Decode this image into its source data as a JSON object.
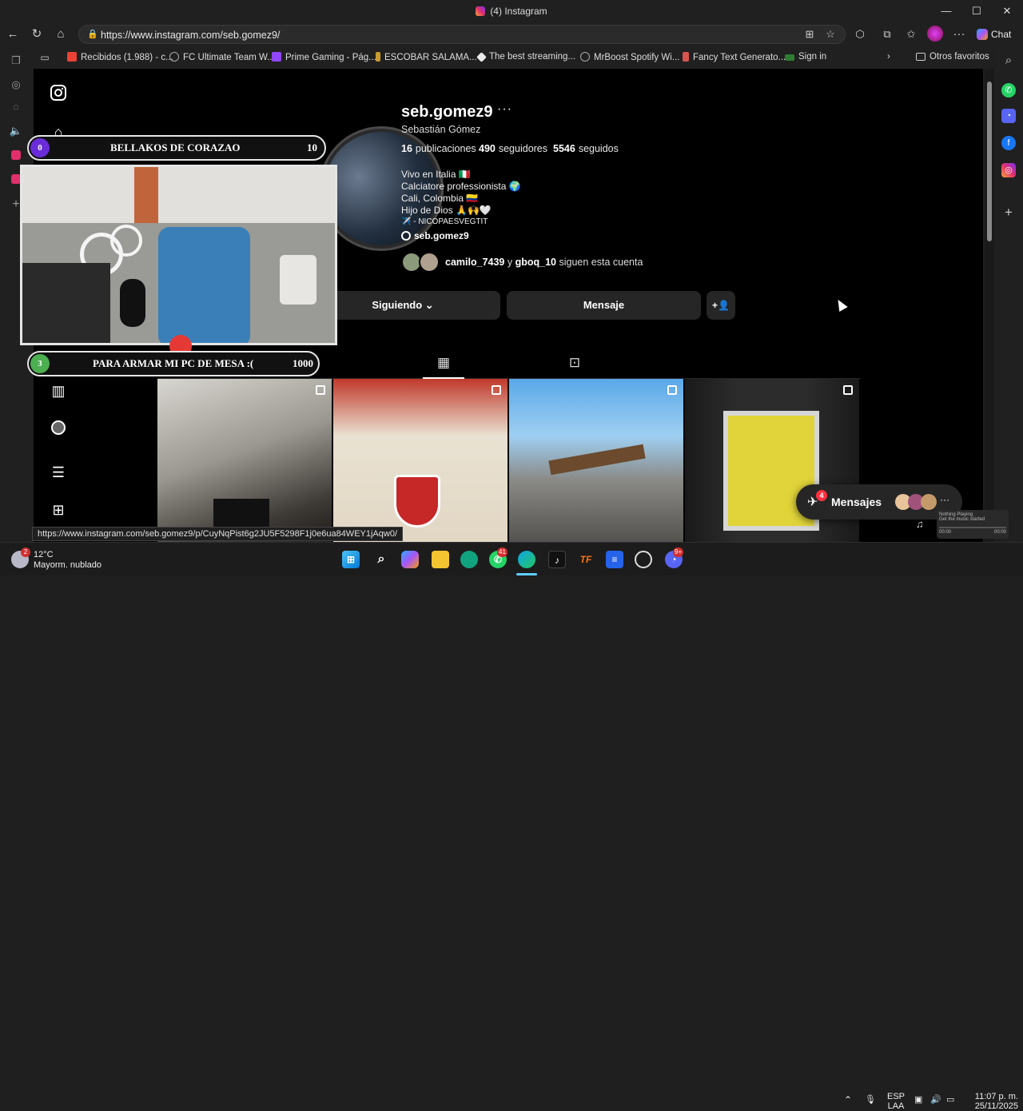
{
  "window": {
    "tab_title": "(4) Instagram",
    "minimize": "—",
    "maximize": "☐",
    "close": "✕"
  },
  "browser": {
    "url": "https://www.instagram.com/seb.gomez9/",
    "chat_label": "Chat",
    "bookmarks": [
      {
        "label": "Recibidos (1.988) - c...",
        "icon": "gmail-icon",
        "color": "#ea4335"
      },
      {
        "label": "FC Ultimate Team W...",
        "icon": "globe-icon",
        "color": "#888888"
      },
      {
        "label": "Prime Gaming - Pág...",
        "icon": "prime-gaming-icon",
        "color": "#9146ff"
      },
      {
        "label": "ESCOBAR SALAMA...",
        "icon": "bookmark-icon",
        "color": "#c99a2e"
      },
      {
        "label": "The best streaming...",
        "icon": "streaming-icon",
        "color": "#e8e8e8"
      },
      {
        "label": "MrBoost Spotify Wi...",
        "icon": "globe-icon",
        "color": "#888888"
      },
      {
        "label": "Fancy Text Generato...",
        "icon": "bookmark-icon",
        "color": "#d9534f"
      },
      {
        "label": "Sign in",
        "icon": "site-icon",
        "color": "#2e7d32"
      }
    ],
    "other_favorites": "Otros favoritos",
    "status_url": "https://www.instagram.com/seb.gomez9/p/CuyNqPist6g2JU5F5298F1j0e6ua84WEY1jAqw0/"
  },
  "profile": {
    "username": "seb.gomez9",
    "more": "···",
    "full_name": "Sebastián Gómez",
    "stats": [
      {
        "value": "16",
        "label": "publicaciones"
      },
      {
        "value": "490",
        "label": "seguidores"
      },
      {
        "value": "5546",
        "label": "seguidos"
      }
    ],
    "bio": [
      "Vivo en Italia 🇮🇹",
      "Calciatore professionista 🌍",
      "Cali, Colombia 🇨🇴",
      "Hijo de Dios 🙏🙌🤍",
      "✈️ - NICOPAESVEGTIT"
    ],
    "threads_handle": "seb.gomez9",
    "followed_by_user1": "camilo_7439",
    "followed_by_and": "y",
    "followed_by_user2": "gboq_10",
    "followed_by_suffix": "siguen esta cuenta",
    "following_button": "Siguiendo",
    "message_button": "Mensaje",
    "add_person_icon": "+👤"
  },
  "overlay": {
    "goal1": {
      "left": "0",
      "title": "BELLAKOS DE CORAZAO",
      "right": "10",
      "color": "#6a2bd8"
    },
    "goal2": {
      "left": "3",
      "title": "PARA ARMAR MI PC DE MESA :(",
      "right": "1000",
      "color": "#4caf50"
    }
  },
  "messages": {
    "label": "Mensajes",
    "badge": "4"
  },
  "music_widget": {
    "title": "Nothing Playing",
    "sub": "Get the music started",
    "t1": "00:00",
    "t2": "00:00"
  },
  "taskbar": {
    "weather_temp": "12°C",
    "weather_desc": "Mayorm. nublado",
    "weather_badge": "2",
    "whatsapp_badge": "41",
    "discord_badge": "9+",
    "lang1": "ESP",
    "lang2": "LAA",
    "time": "11:07 p. m.",
    "date": "25/11/2025"
  }
}
